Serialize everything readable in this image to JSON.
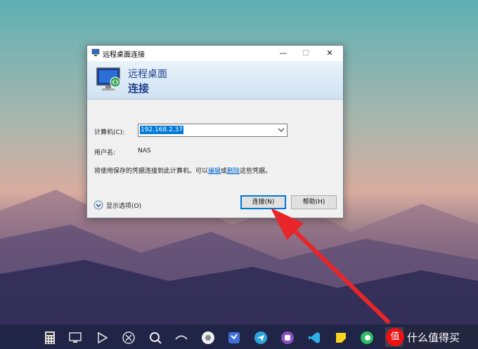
{
  "window": {
    "title": "远程桌面连接",
    "minimize_glyph": "—",
    "maximize_glyph": "☐",
    "close_glyph": "✕"
  },
  "banner": {
    "line1": "远程桌面",
    "line2": "连接"
  },
  "form": {
    "computer_label": "计算机(C):",
    "computer_value": "192.168.2.37",
    "username_label": "用户名:",
    "username_value": "NAS",
    "note_prefix": "将使用保存的凭据连接到此计算机。可以",
    "note_edit_link": "编辑",
    "note_or": "或",
    "note_delete_link": "删除",
    "note_suffix": "这些凭据。"
  },
  "footer": {
    "show_options": "显示选项(O)",
    "connect_button": "连接(N)",
    "help_button": "帮助(H)"
  },
  "taskbar": {
    "icons": [
      "calculator-icon",
      "remote-desktop-icon",
      "play-icon",
      "tools-icon",
      "search-icon",
      "link-icon",
      "chrome-icon",
      "vscode-blue-icon",
      "telegram-icon",
      "purple-app-icon",
      "visual-studio-icon",
      "sticky-notes-icon",
      "evernote-icon",
      "remote-desktop-active-icon"
    ]
  },
  "watermark": {
    "logo_text": "值",
    "text": "什么值得买"
  },
  "colors": {
    "accent": "#0078d7",
    "arrow": "#e8262a",
    "banner_text": "#1c3f8c"
  }
}
